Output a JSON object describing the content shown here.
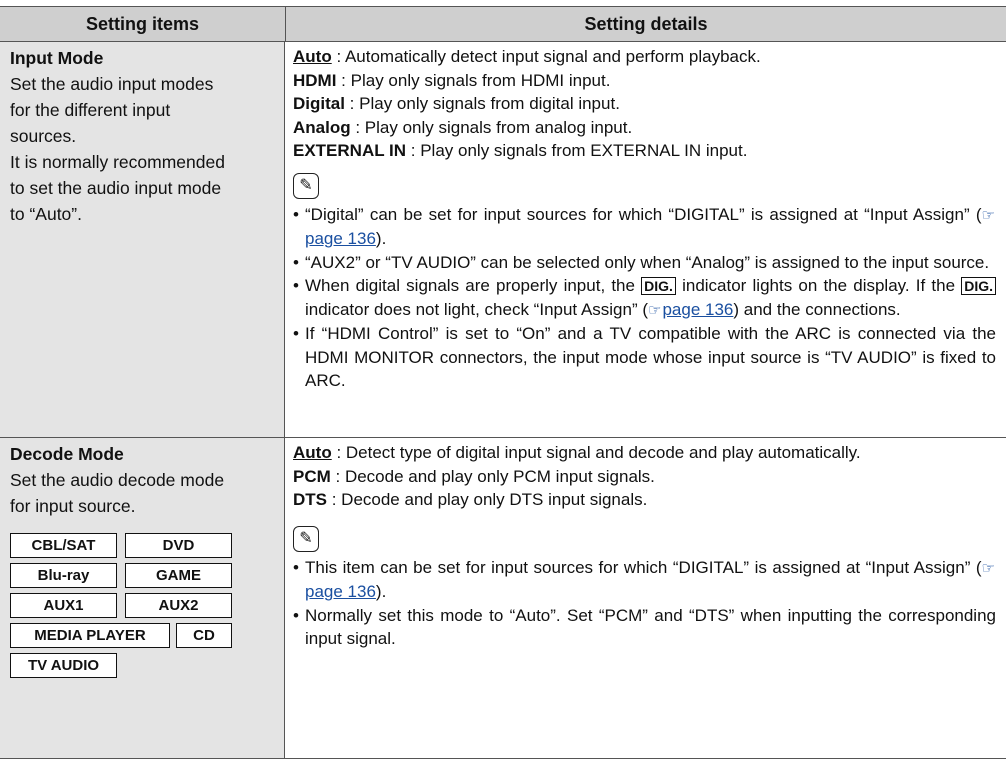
{
  "header": {
    "col1": "Setting items",
    "col2": "Setting details"
  },
  "input_mode": {
    "title": "Input Mode",
    "desc": [
      "Set the audio input modes",
      "for the different input",
      "sources.",
      "It is normally recommended",
      "to set the audio input mode",
      "to “Auto”."
    ],
    "options": [
      {
        "name": "Auto",
        "text": " : Automatically detect input signal and perform playback."
      },
      {
        "name": "HDMI",
        "text": " : Play only signals from HDMI input."
      },
      {
        "name": "Digital",
        "text": " : Play only signals from digital input."
      },
      {
        "name": "Analog",
        "text": " : Play only signals from analog input."
      },
      {
        "name": "EXTERNAL IN",
        "text": " : Play only signals from EXTERNAL IN input."
      }
    ],
    "notes": {
      "n1a": "“Digital” can be set for input sources for which “DIGITAL” is assigned at “Input Assign” (",
      "n1link": "page 136",
      "n1b": ").",
      "n2": "“AUX2” or “TV AUDIO” can be selected only when “Analog” is assigned to the input source.",
      "n3a": "When digital signals are properly input, the ",
      "indicator": "DIG.",
      "n3b": " indicator lights on the display. If the ",
      "n3c": " indicator does not light, check “Input Assign” (",
      "n3link": "page 136",
      "n3d": ") and the connections.",
      "n4": "If “HDMI Control” is set to “On” and a TV compatible with the ARC is connected via the HDMI MONITOR connectors, the input mode whose input source is “TV AUDIO” is fixed to ARC."
    }
  },
  "decode_mode": {
    "title": "Decode Mode",
    "desc": [
      "Set the audio decode mode",
      "for input source."
    ],
    "options": [
      {
        "name": "Auto",
        "text": " : Detect type of digital input signal and decode and play automatically."
      },
      {
        "name": "PCM",
        "text": " : Decode and play only PCM input signals."
      },
      {
        "name": "DTS",
        "text": " : Decode and play only DTS input signals."
      }
    ],
    "sources": [
      "CBL/SAT",
      "DVD",
      "Blu-ray",
      "GAME",
      "AUX1",
      "AUX2",
      "MEDIA PLAYER",
      "CD",
      "TV AUDIO"
    ],
    "notes": {
      "n1a": "This item can be set for input sources for which “DIGITAL” is assigned at “Input Assign” (",
      "n1link": "page 136",
      "n1b": ").",
      "n2": "Normally set this mode to “Auto”. Set “PCM” and “DTS” when inputting the corresponding input signal."
    }
  }
}
